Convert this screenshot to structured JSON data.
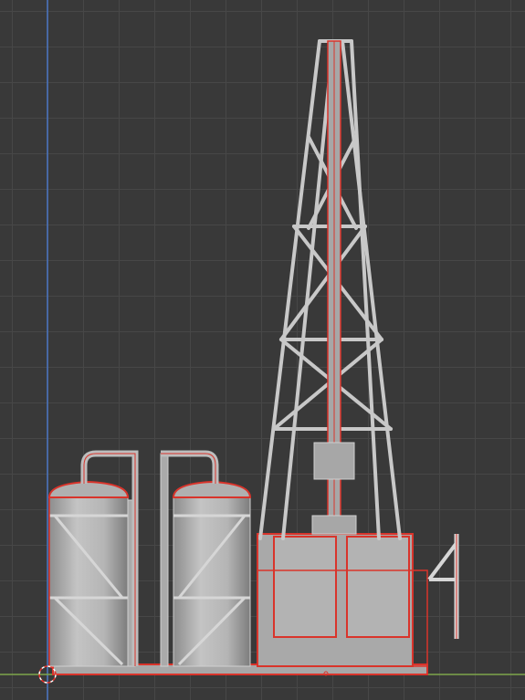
{
  "viewport": {
    "view": "orthographic-front",
    "grid": true,
    "axis_colors": {
      "z_axis": "#4a76c4",
      "x_axis": "#7ea64a"
    },
    "wire_color": "#cfcfcf",
    "selection_outline_color": "#e3322b"
  },
  "scene": {
    "objects": [
      {
        "name": "tank-left",
        "selected": false
      },
      {
        "name": "tank-right",
        "selected": false
      },
      {
        "name": "derrick-tower",
        "selected": false
      },
      {
        "name": "drill-pipe",
        "selected": true
      },
      {
        "name": "base-platform",
        "selected": true
      },
      {
        "name": "machinery-blocks",
        "selected": true
      },
      {
        "name": "side-railing",
        "selected": true
      }
    ]
  },
  "cursor": {
    "icon": "3d-cursor-icon"
  }
}
